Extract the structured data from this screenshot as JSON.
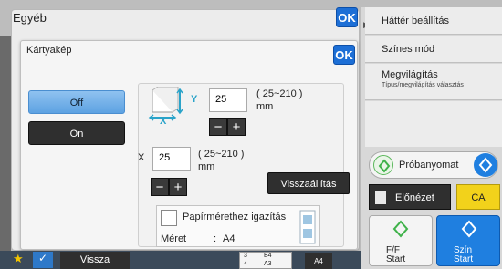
{
  "outer": {
    "title": "Egyéb",
    "ok_label": "OK"
  },
  "inner": {
    "title": "Kártyakép",
    "ok_label": "OK",
    "mode_off": "Off",
    "mode_on": "On",
    "y_label": "Y",
    "y_value": "25",
    "y_range": "( 25~210 )",
    "y_unit": "mm",
    "x_label": "X",
    "x_value": "25",
    "x_range": "( 25~210 )",
    "x_unit": "mm",
    "minus": "−",
    "plus": "+",
    "reset_label": "Visszaállítás",
    "fit_label": "Papírmérethez igazítás",
    "size_label": "Méret",
    "size_sep": ":",
    "size_value": "A4"
  },
  "right_panel": {
    "items": [
      "Háttér beállítás",
      "Színes mód",
      "Megvilágítás"
    ],
    "item3_sub": "Típus/megvilágítás választás",
    "preview_label": "Próbanyomat",
    "elonezet_label": "Előnézet",
    "ca_label": "CA",
    "ff_start_line1": "F/F",
    "ff_start_line2": "Start",
    "color_start_line1": "Szín",
    "color_start_line2": "Start"
  },
  "taskbar": {
    "back_label": "Vissza",
    "tray_row1": [
      "3",
      "B4"
    ],
    "tray_row2": [
      "4",
      "A3"
    ],
    "tray_paper": "A4"
  },
  "colors": {
    "accent_blue": "#1d6fd6",
    "ca_yellow": "#f2d21b",
    "start_green": "#3fb24a"
  }
}
